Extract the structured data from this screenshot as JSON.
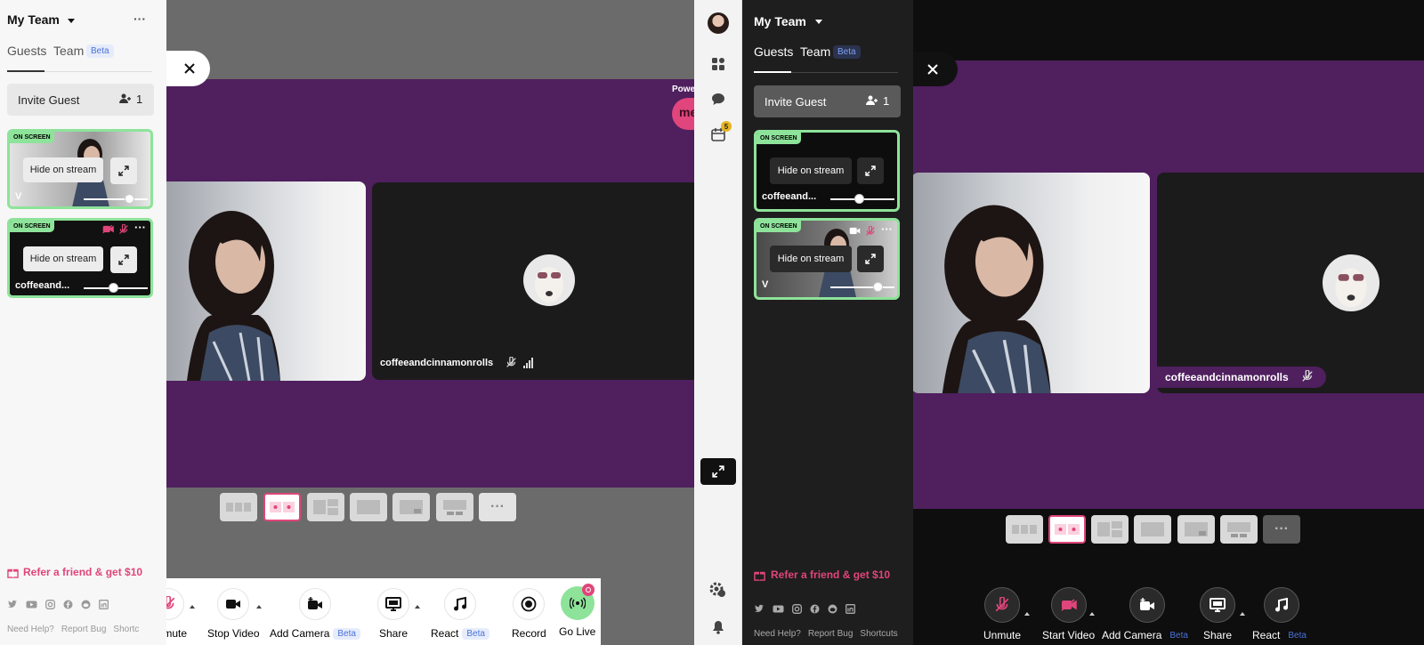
{
  "left": {
    "sidebar": {
      "team_name": "My Team",
      "tabs": [
        {
          "label": "Guests"
        },
        {
          "label": "Team",
          "badge": "Beta"
        }
      ],
      "invite_label": "Invite Guest",
      "invite_count": "1",
      "guests": [
        {
          "badge": "ON SCREEN",
          "hide_label": "Hide on stream",
          "name": "V",
          "volume": 0.75
        },
        {
          "badge": "ON SCREEN",
          "hide_label": "Hide on stream",
          "name": "coffeeand...",
          "volume": 0.45
        }
      ],
      "refer_label": "Refer a friend & get $10",
      "footer_links": [
        "Need Help?",
        "Report Bug",
        "Shortc"
      ]
    },
    "stage": {
      "powered_label": "Powe",
      "participant_name": "coffeeandcinnamonrolls"
    },
    "controls": [
      {
        "label": "Unmute"
      },
      {
        "label": "Stop Video"
      },
      {
        "label": "Add Camera",
        "badge": "Beta"
      },
      {
        "label": "Share"
      },
      {
        "label": "React",
        "badge": "Beta"
      },
      {
        "label": "Record"
      },
      {
        "label": "Go Live"
      }
    ]
  },
  "right": {
    "sidebar": {
      "team_name": "My Team",
      "tabs": [
        {
          "label": "Guests"
        },
        {
          "label": "Team",
          "badge": "Beta"
        }
      ],
      "invite_label": "Invite Guest",
      "invite_count": "1",
      "guests": [
        {
          "badge": "ON SCREEN",
          "hide_label": "Hide on stream",
          "name": "coffeeand...",
          "volume": 0.45
        },
        {
          "badge": "ON SCREEN",
          "hide_label": "Hide on stream",
          "name": "V",
          "volume": 0.7
        }
      ],
      "refer_label": "Refer a friend & get $10",
      "footer_links": [
        "Need Help?",
        "Report Bug",
        "Shortcuts"
      ]
    },
    "rail": {
      "notification_count": "5"
    },
    "stage": {
      "participant_name": "coffeeandcinnamonrolls"
    },
    "controls": [
      {
        "label": "Unmute"
      },
      {
        "label": "Start Video"
      },
      {
        "label": "Add Camera",
        "badge": "Beta"
      },
      {
        "label": "Share"
      },
      {
        "label": "React",
        "badge": "Beta"
      }
    ]
  },
  "colors": {
    "accent_pink": "#e0457b",
    "on_screen_green": "#8ee39a",
    "stage_purple": "#4f1f5e",
    "golive_green": "#8ee39a"
  }
}
